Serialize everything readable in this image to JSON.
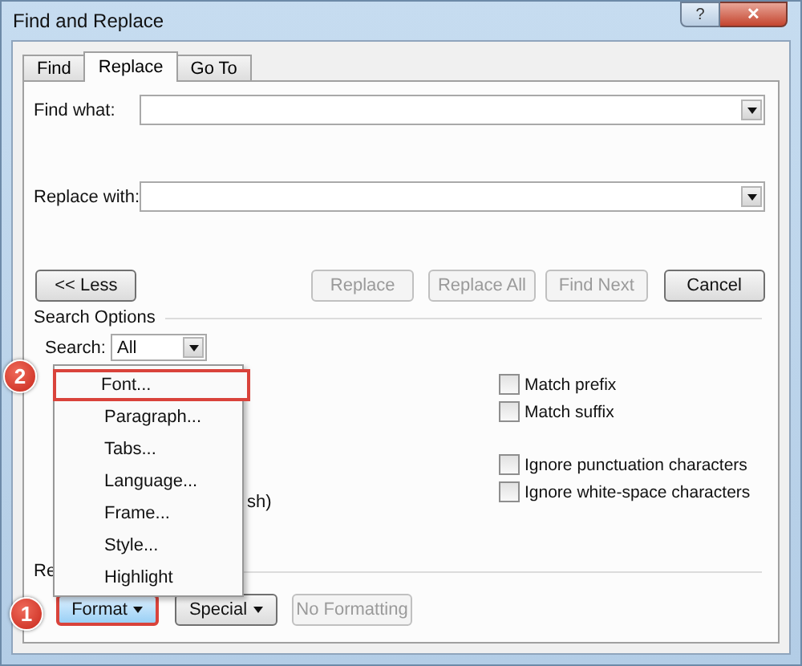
{
  "window": {
    "title": "Find and Replace",
    "help": "?",
    "close": "✕"
  },
  "tabs": [
    {
      "label": "Find",
      "selected": false
    },
    {
      "label": "Replace",
      "selected": true
    },
    {
      "label": "Go To",
      "selected": false
    }
  ],
  "find_what": {
    "label": "Find what:"
  },
  "replace_with": {
    "label": "Replace with:"
  },
  "action_buttons": [
    {
      "label": "<< Less",
      "disabled": false
    },
    {
      "label": "Replace",
      "disabled": true
    },
    {
      "label": "Replace All",
      "disabled": true
    },
    {
      "label": "Find Next",
      "disabled": true
    },
    {
      "label": "Cancel",
      "disabled": false
    }
  ],
  "search_options": {
    "label": "Search Options",
    "search_label": "Search:",
    "search_value": "All",
    "checkboxes": [
      {
        "label": "Match prefix",
        "checked": false
      },
      {
        "label": "Match suffix",
        "checked": false
      },
      {
        "label": "Ignore punctuation characters",
        "checked": false
      },
      {
        "label": "Ignore white-space characters",
        "checked": false
      }
    ],
    "covered_text": "sh)"
  },
  "replace_section": {
    "label": "Re"
  },
  "bottom_buttons": [
    {
      "label": "Format",
      "dropdown": true,
      "disabled": false,
      "highlighted": true
    },
    {
      "label": "Special",
      "dropdown": true,
      "disabled": false,
      "highlighted": false
    },
    {
      "label": "No Formatting",
      "dropdown": false,
      "disabled": true,
      "highlighted": false
    }
  ],
  "format_menu": [
    {
      "label": "Font...",
      "selected": true
    },
    {
      "label": "Paragraph...",
      "selected": false
    },
    {
      "label": "Tabs...",
      "selected": false
    },
    {
      "label": "Language...",
      "selected": false
    },
    {
      "label": "Frame...",
      "selected": false
    },
    {
      "label": "Style...",
      "selected": false
    },
    {
      "label": "Highlight",
      "selected": false
    }
  ],
  "callouts": [
    "2",
    "1"
  ]
}
